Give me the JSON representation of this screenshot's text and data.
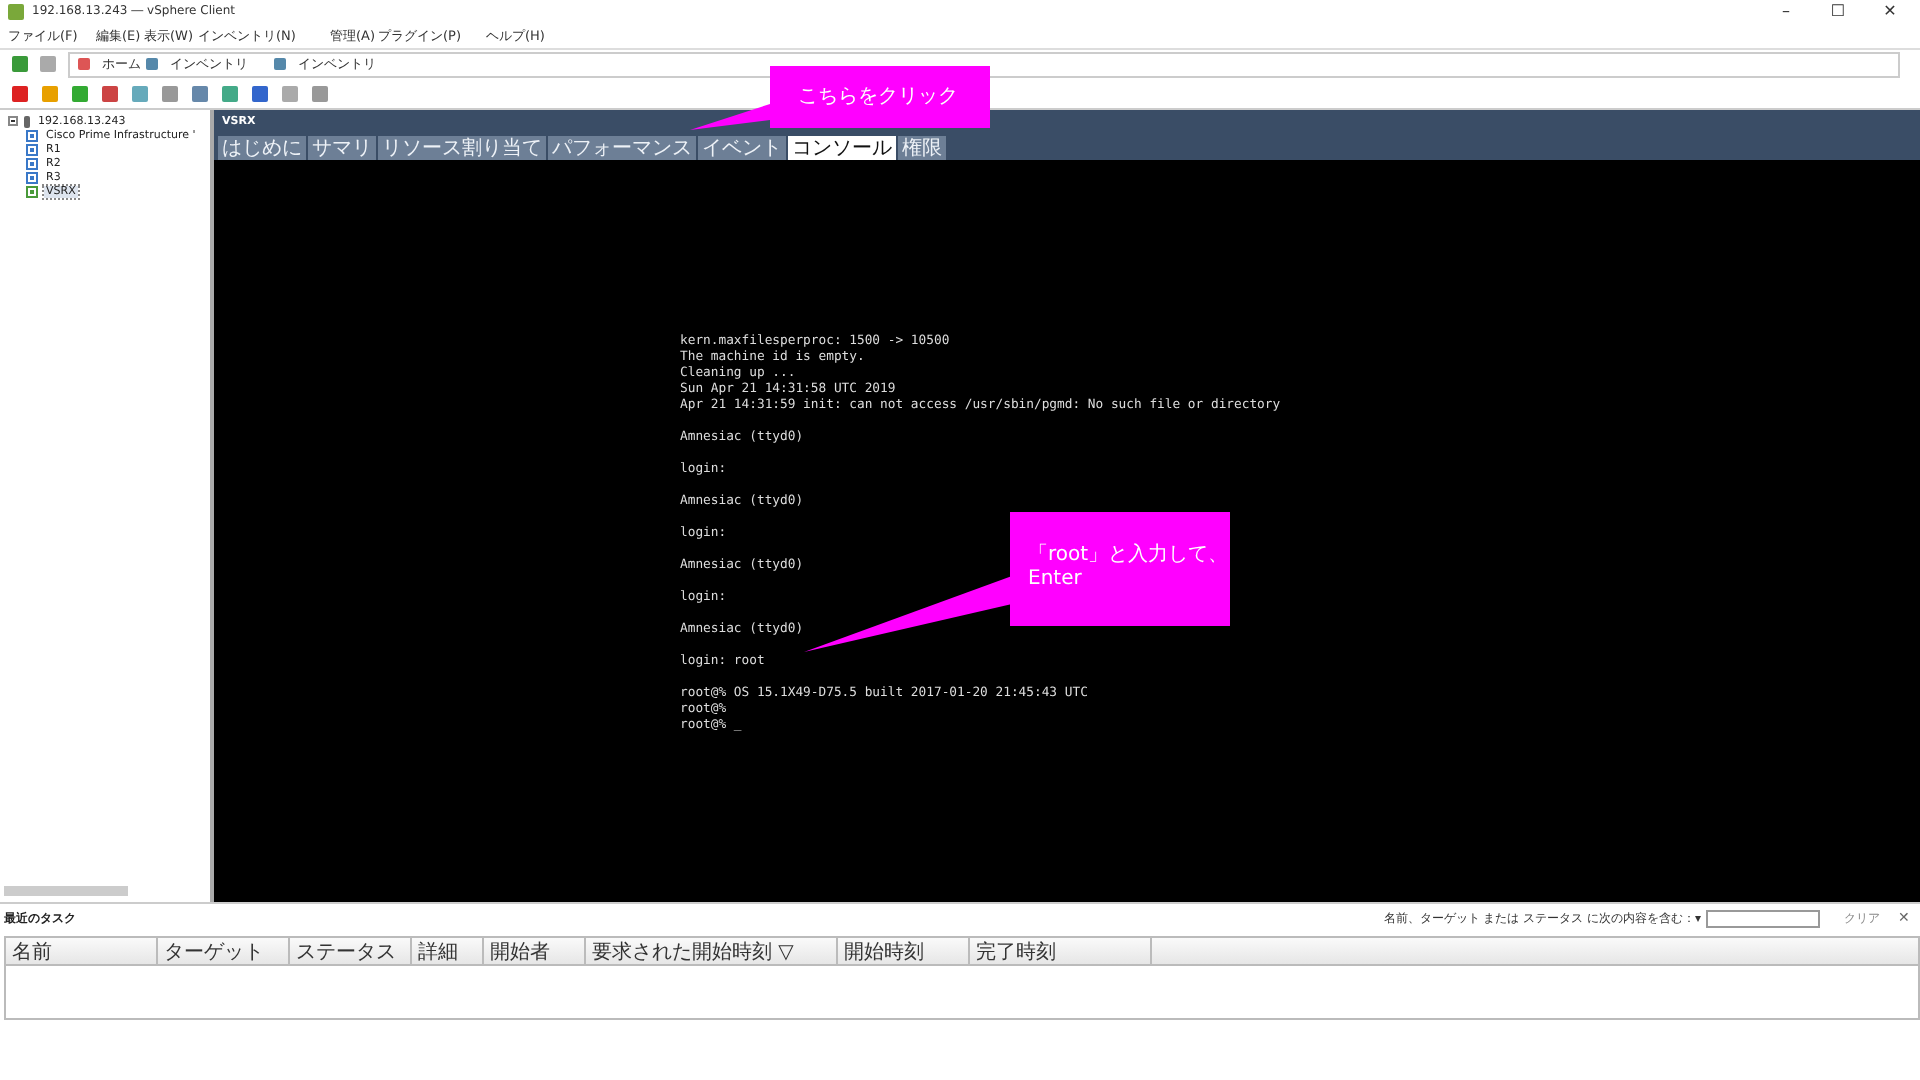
{
  "window": {
    "title": "192.168.13.243 ― vSphere Client",
    "controls": [
      "–",
      "☐",
      "✕"
    ]
  },
  "menu": [
    "ファイル(F)",
    "編集(E)",
    "表示(W)",
    "インベントリ(N)",
    "管理(A)",
    "プラグイン(P)",
    "ヘルプ(H)"
  ],
  "breadcrumb": [
    "ホーム",
    "インベントリ",
    "インベントリ"
  ],
  "tree": {
    "label": "192.168.13.243",
    "expanded": true,
    "children": [
      {
        "label": "Cisco Prime Infrastructure '",
        "selected": false,
        "kind": "vm"
      },
      {
        "label": "R1",
        "selected": false,
        "kind": "vm"
      },
      {
        "label": "R2",
        "selected": false,
        "kind": "vm"
      },
      {
        "label": "R3",
        "selected": false,
        "kind": "vm"
      },
      {
        "label": "VSRX",
        "selected": true,
        "kind": "vm-on"
      }
    ]
  },
  "panel": {
    "title": "VSRX",
    "tabs": [
      {
        "label": "はじめに",
        "selected": false
      },
      {
        "label": "サマリ",
        "selected": false
      },
      {
        "label": "リソース割り当て",
        "selected": false
      },
      {
        "label": "パフォーマンス",
        "selected": false
      },
      {
        "label": "イベント",
        "selected": false
      },
      {
        "label": "コンソール",
        "selected": true
      },
      {
        "label": "権限",
        "selected": false
      }
    ]
  },
  "console": [
    [
      "kern.maxfilesperproc: 1500 -> 10500",
      "The machine id is empty.",
      "Cleaning up ...",
      "Sun Apr 21 14:31:58 UTC 2019",
      "Apr 21 14:31:59 init: can not access /usr/sbin/pgmd: No such file or directory"
    ],
    [
      "Amnesiac (ttyd0)"
    ],
    [
      "login:"
    ],
    [
      "Amnesiac (ttyd0)"
    ],
    [
      "login:"
    ],
    [
      "Amnesiac (ttyd0)"
    ],
    [
      "login:"
    ],
    [
      "Amnesiac (ttyd0)"
    ],
    [
      "login: root"
    ],
    [
      "root@% OS 15.1X49-D75.5 built 2017-01-20 21:45:43 UTC",
      "root@%",
      "root@% _"
    ]
  ],
  "callouts": [
    "こちらをクリック",
    "「root」と入力して、\nEnter"
  ],
  "tasks": {
    "title": "最近のタスク",
    "filter_label": "名前、ターゲット または ステータス に次の内容を含む：▾",
    "clear": "クリア",
    "close": "✕",
    "columns": [
      "名前",
      "ターゲット",
      "ステータス",
      "詳細",
      "開始者",
      "要求された開始時刻 ▽",
      "開始時刻",
      "完了時刻"
    ]
  }
}
